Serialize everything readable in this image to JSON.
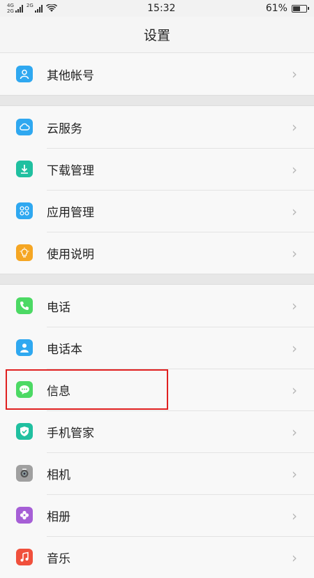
{
  "status": {
    "network_top": "4G",
    "network_bottom": "2G",
    "network_secondary": "2G",
    "time": "15:32",
    "battery": "61%",
    "battery_level": 0.61
  },
  "title": "设置",
  "groups": [
    {
      "items": [
        {
          "label": "其他帐号",
          "icon": "account-icon",
          "color": "#2fa8f0"
        }
      ]
    },
    {
      "items": [
        {
          "label": "云服务",
          "icon": "cloud-icon",
          "color": "#2fa8f0"
        },
        {
          "label": "下载管理",
          "icon": "download-icon",
          "color": "#20c0a0"
        },
        {
          "label": "应用管理",
          "icon": "apps-icon",
          "color": "#2fa8f0"
        },
        {
          "label": "使用说明",
          "icon": "lightbulb-icon",
          "color": "#f5a623"
        }
      ]
    },
    {
      "items": [
        {
          "label": "电话",
          "icon": "phone-icon",
          "color": "#4cd964"
        },
        {
          "label": "电话本",
          "icon": "contacts-icon",
          "color": "#2fa8f0"
        },
        {
          "label": "信息",
          "icon": "message-icon",
          "color": "#4cd964"
        },
        {
          "label": "手机管家",
          "icon": "shield-icon",
          "color": "#20c0a0"
        },
        {
          "label": "相机",
          "icon": "camera-icon",
          "color": "#a0a0a0"
        },
        {
          "label": "相册",
          "icon": "gallery-icon",
          "color": "#a65fd6"
        },
        {
          "label": "音乐",
          "icon": "music-icon",
          "color": "#f0503c"
        }
      ]
    }
  ]
}
